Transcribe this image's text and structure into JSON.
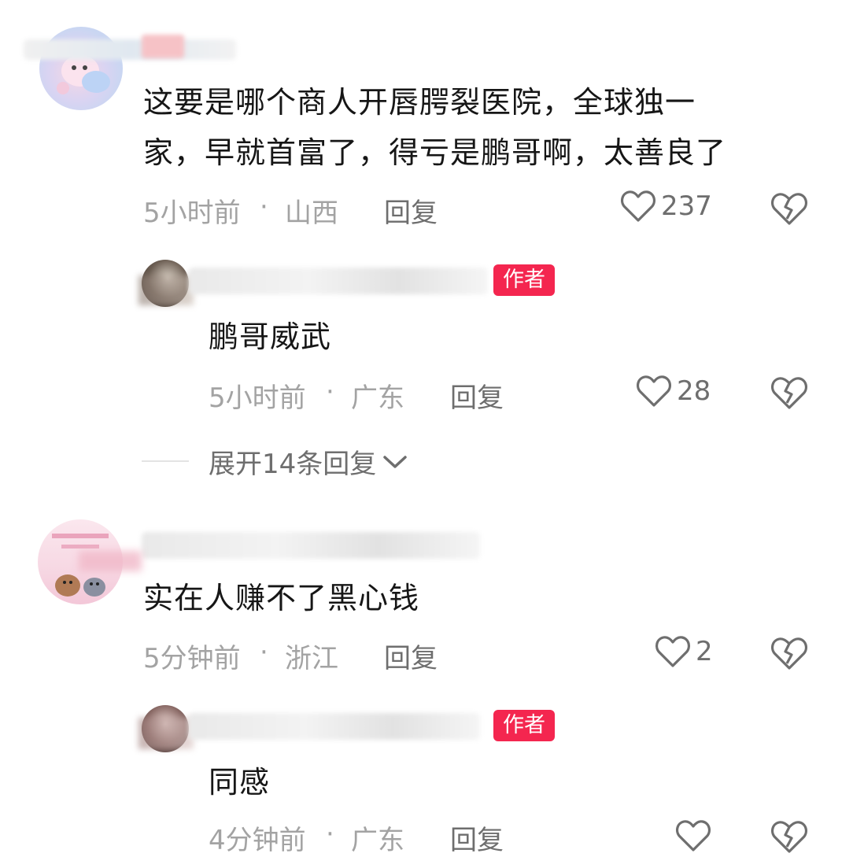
{
  "comments": [
    {
      "text_line1": "这要是哪个商人开唇腭裂医院，全球独一",
      "text_line2": "家，早就首富了，得亏是鹏哥啊，太善良了",
      "time": "5小时前",
      "location": "山西",
      "reply_label": "回复",
      "likes": "237",
      "replies": [
        {
          "badge": "作者",
          "text": "鹏哥威武",
          "time": "5小时前",
          "location": "广东",
          "reply_label": "回复",
          "likes": "28"
        }
      ],
      "expand_label": "展开14条回复"
    },
    {
      "text": "实在人赚不了黑心钱",
      "time": "5分钟前",
      "location": "浙江",
      "reply_label": "回复",
      "likes": "2",
      "replies": [
        {
          "badge": "作者",
          "text": "同感",
          "time": "4分钟前",
          "location": "广东",
          "reply_label": "回复"
        }
      ]
    }
  ],
  "separator": "·",
  "colors": {
    "badge": "#f4264f",
    "meta": "#a3a3a3",
    "action": "#6e6e6e"
  },
  "icons": [
    "heart-outline-icon",
    "broken-heart-icon",
    "chevron-down-icon"
  ]
}
